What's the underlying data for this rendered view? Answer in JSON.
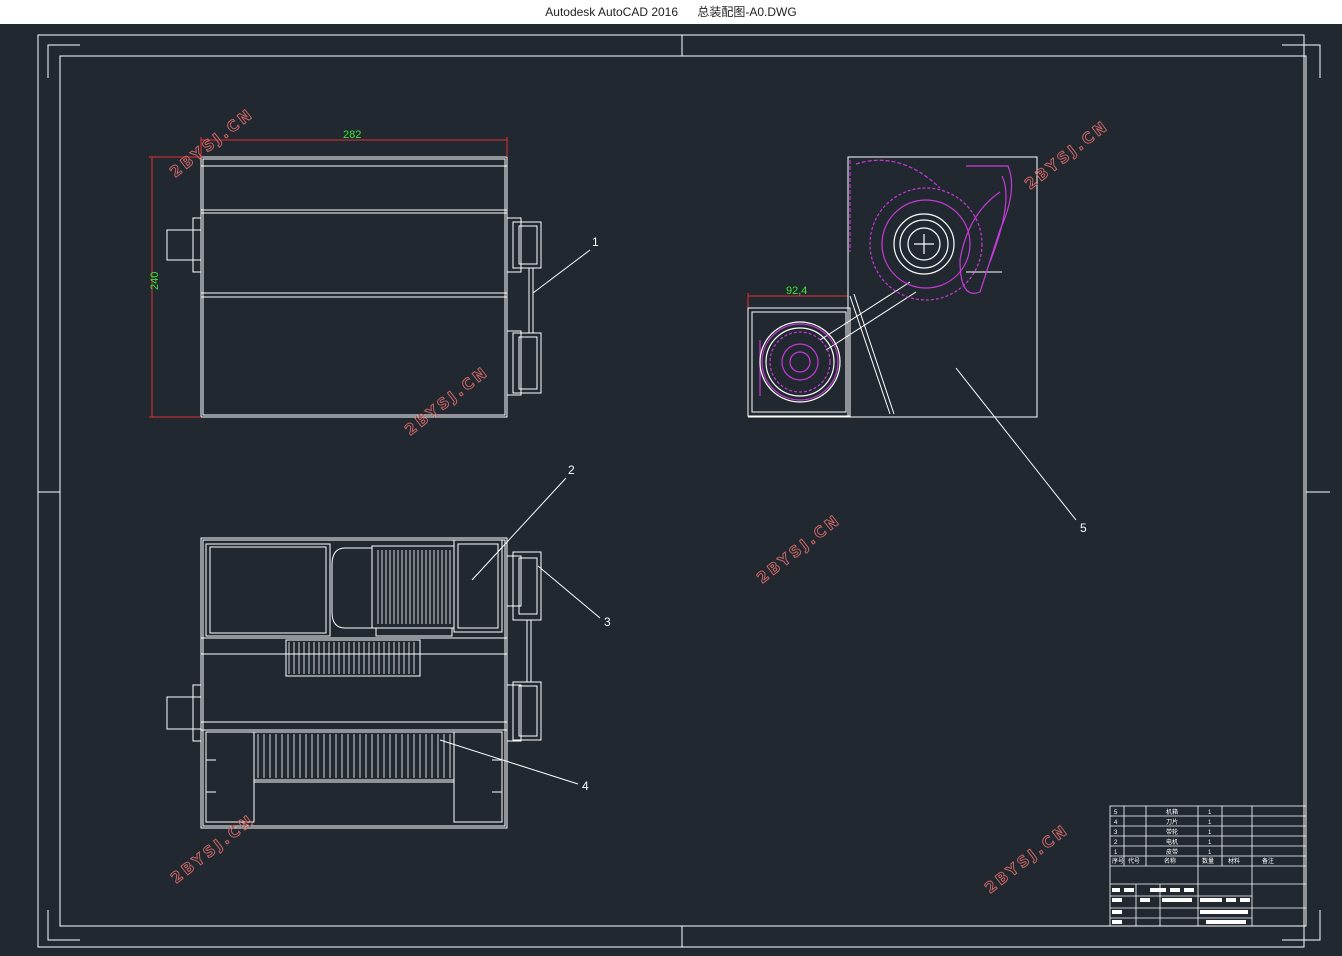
{
  "window": {
    "app_title": "Autodesk AutoCAD 2016",
    "file_name": "总装配图-A0.DWG"
  },
  "drawing": {
    "background": "#212830",
    "line_color": "#ffffff",
    "dimension_color": "#39e63a",
    "dimension_line_color": "#e03030",
    "hidden_part_color": "#c63bd6",
    "dimensions": {
      "width": "282",
      "height": "240",
      "offset": "92,4"
    },
    "part_labels": [
      "1",
      "2",
      "3",
      "4",
      "5"
    ],
    "watermark": "2BYSJ.CN"
  },
  "title_block": {
    "parts": [
      {
        "no": "5",
        "name": "机箱",
        "qty": "1"
      },
      {
        "no": "4",
        "name": "刀片",
        "qty": "1"
      },
      {
        "no": "3",
        "name": "带轮",
        "qty": "1"
      },
      {
        "no": "2",
        "name": "电机",
        "qty": "1"
      },
      {
        "no": "1",
        "name": "皮带",
        "qty": "1"
      }
    ],
    "header": {
      "no": "序号",
      "code": "代号",
      "name": "名称",
      "qty": "数量",
      "material": "材料",
      "remark": "备注"
    }
  }
}
